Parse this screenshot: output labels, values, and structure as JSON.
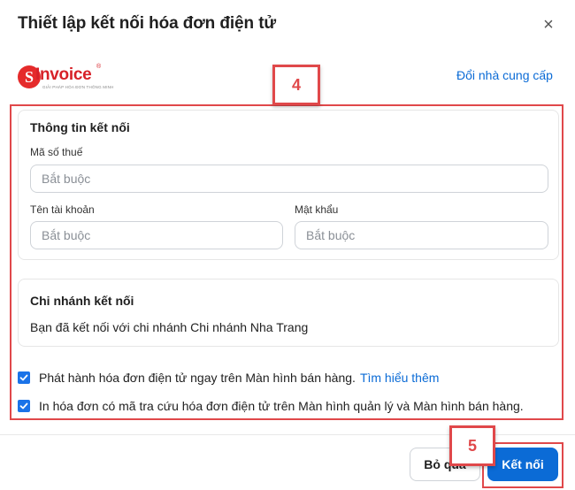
{
  "dialog": {
    "title": "Thiết lập kết nối hóa đơn điện tử",
    "close_icon": "×",
    "change_provider_label": "Đổi nhà cung cấp"
  },
  "logo": {
    "letter": "S",
    "text": "Invoice",
    "tm": "®",
    "sub": "GIẢI PHÁP HÓA ĐƠN THÔNG MINH"
  },
  "callouts": {
    "step_connection": "4",
    "step_button": "5"
  },
  "connection": {
    "title": "Thông tin kết nối",
    "tax_code_label": "Mã số thuế",
    "tax_code_placeholder": "Bắt buộc",
    "username_label": "Tên tài khoản",
    "username_placeholder": "Bắt buộc",
    "password_label": "Mật khẩu",
    "password_placeholder": "Bắt buộc"
  },
  "branch": {
    "title": "Chi nhánh kết nối",
    "text": "Bạn đã kết nối với chi nhánh Chi nhánh Nha Trang"
  },
  "options": [
    {
      "label": "Phát hành hóa đơn điện tử ngay trên Màn hình bán hàng.",
      "link": "Tìm hiểu thêm",
      "checked": true
    },
    {
      "label": "In hóa đơn có mã tra cứu hóa đơn điện tử trên Màn hình quản lý và Màn hình bán hàng.",
      "checked": true
    }
  ],
  "footer": {
    "skip_label": "Bỏ qua",
    "connect_label": "Kết nối"
  },
  "colors": {
    "accent": "#0b6bd6",
    "brand_red": "#d72128",
    "annotation_red": "#e0484a"
  }
}
